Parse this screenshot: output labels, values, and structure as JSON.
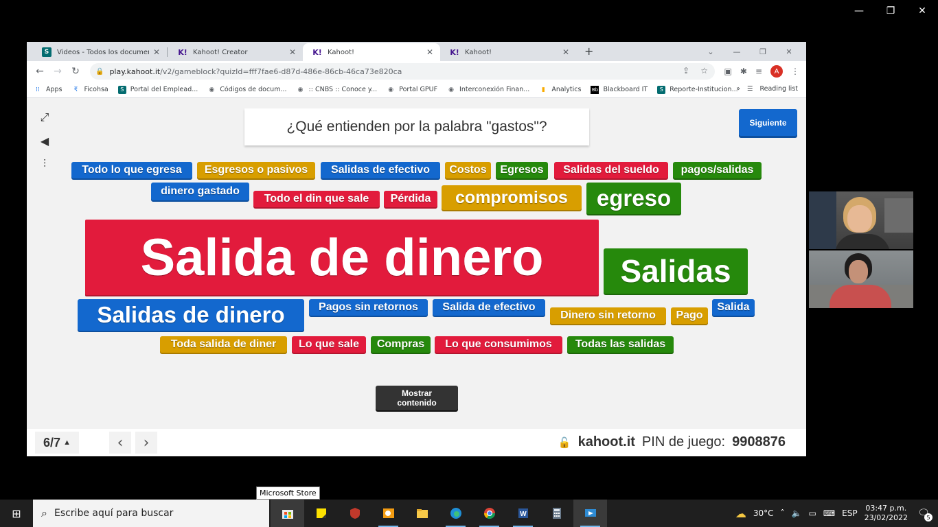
{
  "outer_window": {
    "minimize": "—",
    "restore": "❐",
    "close": "✕"
  },
  "tabs": [
    {
      "label": "Videos - Todos los documentos",
      "icon": "sharepoint-icon"
    },
    {
      "label": "Kahoot! Creator",
      "icon": "kahoot-icon"
    },
    {
      "label": "Kahoot!",
      "icon": "kahoot-icon",
      "active": true
    },
    {
      "label": "Kahoot!",
      "icon": "kahoot-icon"
    }
  ],
  "address_bar": {
    "domain": "play.kahoot.it",
    "path": "/v2/gameblock?quizId=fff7fae6-d87d-486e-86cb-46ca73e820ca"
  },
  "profile_initial": "A",
  "bookmarks": [
    {
      "label": "Apps",
      "icon": "apps-grid-icon"
    },
    {
      "label": "Ficohsa",
      "icon": "ficohsa-icon"
    },
    {
      "label": "Portal del Emplead...",
      "icon": "sharepoint-icon"
    },
    {
      "label": "Códigos de docum...",
      "icon": "globe-icon"
    },
    {
      "label": ":: CNBS :: Conoce y...",
      "icon": "globe-icon"
    },
    {
      "label": "Portal GPUF",
      "icon": "globe-icon"
    },
    {
      "label": "Interconexión Finan...",
      "icon": "globe-icon"
    },
    {
      "label": "Analytics",
      "icon": "analytics-icon"
    },
    {
      "label": "Blackboard IT",
      "icon": "blackboard-icon"
    },
    {
      "label": "Reporte-Institucion...",
      "icon": "sharepoint-icon"
    }
  ],
  "bookmarks_overflow": "»",
  "reading_list": "Reading list",
  "kahoot": {
    "question": "¿Qué entienden por la palabra \"gastos\"?",
    "next_button": "Siguiente",
    "words": [
      {
        "text": "Todo lo que egresa",
        "color": "blue"
      },
      {
        "text": "Esgresos o pasivos",
        "color": "yellow"
      },
      {
        "text": "Salidas de efectivo",
        "color": "blue"
      },
      {
        "text": "Costos",
        "color": "yellow"
      },
      {
        "text": "Egresos",
        "color": "green"
      },
      {
        "text": "Salidas del sueldo",
        "color": "red"
      },
      {
        "text": "pagos/salidas",
        "color": "green"
      },
      {
        "text": "dinero gastado",
        "color": "blue"
      },
      {
        "text": "Todo el din que sale",
        "color": "red"
      },
      {
        "text": "Pérdida",
        "color": "red"
      },
      {
        "text": "compromisos",
        "color": "yellow"
      },
      {
        "text": "egreso",
        "color": "green"
      },
      {
        "text": "Salida de dinero",
        "color": "red"
      },
      {
        "text": "Salidas",
        "color": "green"
      },
      {
        "text": "Salidas de dinero",
        "color": "blue"
      },
      {
        "text": "Pagos sin retornos",
        "color": "blue"
      },
      {
        "text": "Salida de efectivo",
        "color": "blue"
      },
      {
        "text": "Dinero sin retorno",
        "color": "yellow"
      },
      {
        "text": "Pago",
        "color": "yellow"
      },
      {
        "text": "Salida",
        "color": "blue"
      },
      {
        "text": "Toda salida de diner",
        "color": "yellow"
      },
      {
        "text": "Lo que sale",
        "color": "red"
      },
      {
        "text": "Compras",
        "color": "green"
      },
      {
        "text": "Lo que consumimos",
        "color": "red"
      },
      {
        "text": "Todas las salidas",
        "color": "green"
      }
    ],
    "show_content_button": "Mostrar contenido",
    "counter": "6/7",
    "site": "kahoot.it",
    "pin_label": "PIN de juego:",
    "pin": "9908876"
  },
  "tooltip": "Microsoft Store",
  "taskbar": {
    "search_placeholder": "Escribe aquí para buscar",
    "weather": "30°C",
    "language": "ESP",
    "time": "03:47 p.m.",
    "date": "23/02/2022",
    "notifications": "5"
  },
  "colors": {
    "blue": "#1368ce",
    "yellow": "#d89e00",
    "green": "#26890c",
    "red": "#e21b3c"
  }
}
